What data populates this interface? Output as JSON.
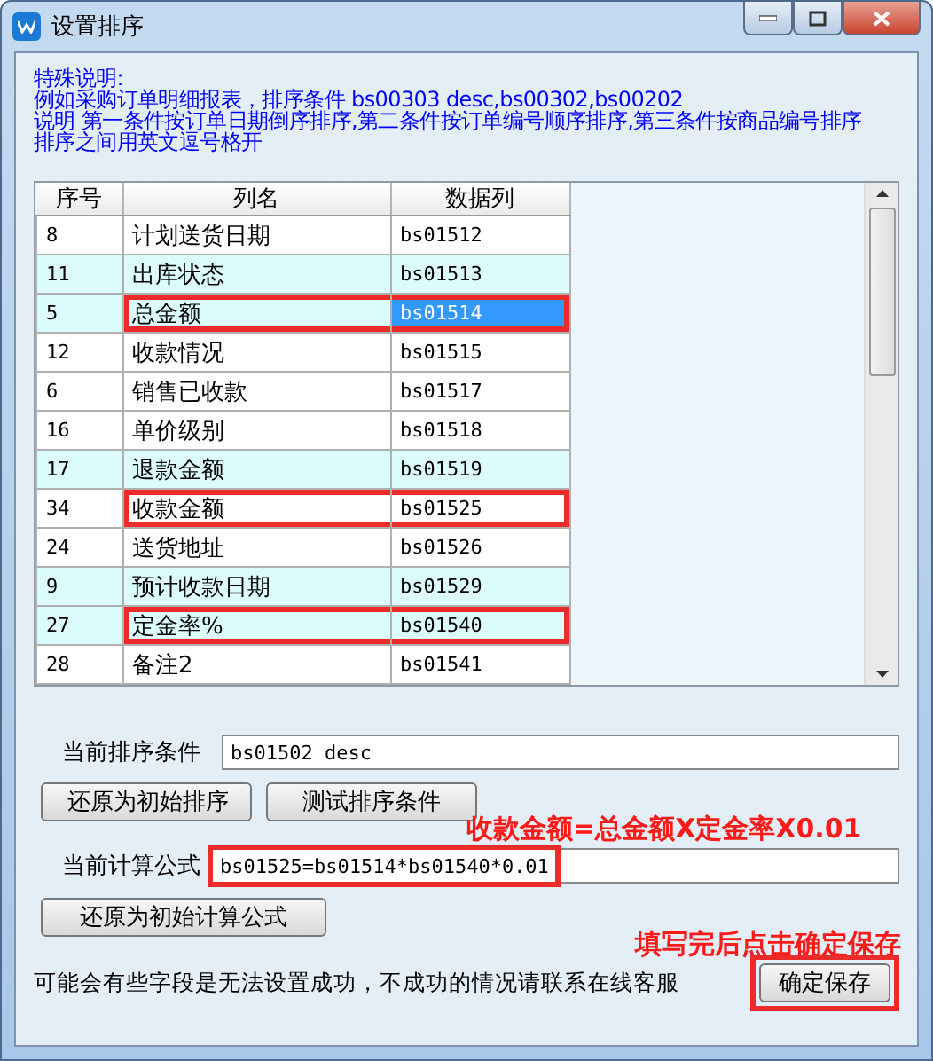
{
  "window": {
    "title": "设置排序"
  },
  "notes": [
    "特殊说明:",
    "例如采购订单明细报表，排序条件 bs00303 desc,bs00302,bs00202",
    "说明 第一条件按订单日期倒序排序,第二条件按订单编号顺序排序,第三条件按商品编号排序",
    "排序之间用英文逗号格开"
  ],
  "table": {
    "columns": [
      "序号",
      "列名",
      "数据列"
    ],
    "rows": [
      {
        "no": "8",
        "name": "计划送货日期",
        "field": "bs01512",
        "shaded": false,
        "highlighted": false,
        "selected": false
      },
      {
        "no": "11",
        "name": "出库状态",
        "field": "bs01513",
        "shaded": true,
        "highlighted": false,
        "selected": false
      },
      {
        "no": "5",
        "name": "总金额",
        "field": "bs01514",
        "shaded": true,
        "highlighted": true,
        "selected": true
      },
      {
        "no": "12",
        "name": "收款情况",
        "field": "bs01515",
        "shaded": false,
        "highlighted": false,
        "selected": false
      },
      {
        "no": "6",
        "name": "销售已收款",
        "field": "bs01517",
        "shaded": false,
        "highlighted": false,
        "selected": false
      },
      {
        "no": "16",
        "name": "单价级别",
        "field": "bs01518",
        "shaded": false,
        "highlighted": false,
        "selected": false
      },
      {
        "no": "17",
        "name": "退款金额",
        "field": "bs01519",
        "shaded": true,
        "highlighted": false,
        "selected": false
      },
      {
        "no": "34",
        "name": "收款金额",
        "field": "bs01525",
        "shaded": false,
        "highlighted": true,
        "selected": false
      },
      {
        "no": "24",
        "name": "送货地址",
        "field": "bs01526",
        "shaded": false,
        "highlighted": false,
        "selected": false
      },
      {
        "no": "9",
        "name": "预计收款日期",
        "field": "bs01529",
        "shaded": true,
        "highlighted": false,
        "selected": false
      },
      {
        "no": "27",
        "name": "定金率%",
        "field": "bs01540",
        "shaded": true,
        "highlighted": true,
        "selected": false
      },
      {
        "no": "28",
        "name": "备注2",
        "field": "bs01541",
        "shaded": false,
        "highlighted": false,
        "selected": false
      }
    ]
  },
  "sort": {
    "label": "当前排序条件",
    "value": "bs01502 desc",
    "buttons": [
      "还原为初始排序",
      "测试排序条件"
    ]
  },
  "formula_annotation": "收款金额=总金额X定金率X0.01",
  "formula": {
    "label": "当前计算公式",
    "value": "bs01525=bs01514*bs01540*0.01",
    "highlighted": true,
    "button": "还原为初始计算公式"
  },
  "save_annotation": "填写完后点击确定保存",
  "footer": {
    "message": "可能会有些字段是无法设置成功，不成功的情况请联系在线客服",
    "save_button": "确定保存",
    "highlighted": true
  }
}
